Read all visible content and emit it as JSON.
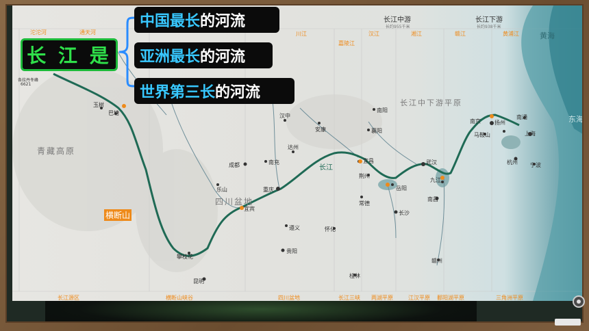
{
  "callout": {
    "main": "长 江 是",
    "facts": [
      {
        "highlight": "中国最长",
        "rest": "的河流"
      },
      {
        "highlight": "亚洲最长",
        "rest": "的河流"
      },
      {
        "highlight": "世界第三长",
        "rest": "的河流"
      }
    ]
  },
  "map": {
    "sections_top": [
      "长江中游",
      "长江下游"
    ],
    "section_lengths": [
      "长约955千米",
      "长约938千米"
    ],
    "sections_bottom": [
      "长江源区",
      "横断山峡谷",
      "四川盆地",
      "长江三峡",
      "两湖平原",
      "江汉平原",
      "鄱阳湖平原",
      "三角洲平原"
    ],
    "tributaries": [
      "沱沱河",
      "通天河",
      "川江",
      "嘉陵江",
      "汉江",
      "湘江",
      "赣江",
      "黄浦江"
    ],
    "regions": [
      "青藏高原",
      "四川盆地",
      "长江中下游平原"
    ],
    "sea_labels": [
      "黄海",
      "东海"
    ],
    "highlight_region": "横断山",
    "peak": {
      "name": "各拉丹冬峰",
      "elevation": "6621"
    },
    "river_label": "长江",
    "cities": [
      "玉树",
      "巴塘",
      "汉中",
      "安康",
      "南阳",
      "襄阳",
      "成都",
      "南充",
      "达州",
      "乐山",
      "重庆",
      "宜宾",
      "宜昌",
      "荆州",
      "岳阳",
      "武汉",
      "常德",
      "长沙",
      "九江",
      "南昌",
      "遵义",
      "贵阳",
      "怀化",
      "昆明",
      "攀枝花",
      "桂林",
      "赣州",
      "南京",
      "马鞍山",
      "扬州",
      "南通",
      "上海",
      "杭州",
      "宁波"
    ]
  },
  "colors": {
    "river": "#1f6a55",
    "tag_highlight": "#38c8ff",
    "main_text": "#2fe04a",
    "label_orange": "#ee8a1a"
  }
}
